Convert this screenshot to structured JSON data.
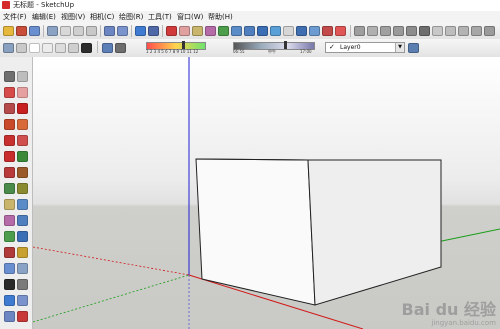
{
  "window": {
    "title": "无标题 - SketchUp"
  },
  "menu": [
    "文件(F)",
    "编辑(E)",
    "视图(V)",
    "相机(C)",
    "绘图(R)",
    "工具(T)",
    "窗口(W)",
    "帮助(H)"
  ],
  "toolbar_top": {
    "icons": [
      "select-icon",
      "orbit-icon",
      "pan-icon",
      "zoom-icon",
      "zoom-extents-icon",
      "prev-view-icon",
      "next-view-icon",
      "walk-icon",
      "look-around-icon",
      "position-camera-icon",
      "section-plane-icon",
      "paint-bucket-icon",
      "eraser-icon",
      "tape-measure-icon",
      "protractor-icon",
      "axes-icon",
      "dimension-icon",
      "text-icon",
      "3d-text-icon",
      "move-icon",
      "push-pull-icon",
      "rotate-icon",
      "follow-me-icon",
      "scale-icon",
      "offset-icon",
      "components-icon",
      "materials-icon",
      "styles-icon",
      "layers-icon",
      "scenes-icon",
      "shadows-icon",
      "fog-icon",
      "match-photo-icon",
      "soften-icon",
      "outliner-icon",
      "entity-info-icon"
    ]
  },
  "toolbar_second": {
    "style_icons": [
      "xray-icon",
      "back-edges-icon",
      "wireframe-icon",
      "hidden-line-icon",
      "shaded-icon",
      "shaded-textures-icon",
      "monochrome-icon"
    ],
    "shadow_ticks": "1 2 3 4 5 6 7 8 9 10 11 12",
    "shadow_months_fill": 0.62,
    "time_start": "06:55",
    "time_mid": "中午",
    "time_end": "17:00",
    "layer_name": "Layer0",
    "layer_checked": "✓"
  },
  "left_tools": [
    "select-icon",
    "component-icon",
    "paint-icon",
    "eraser-icon",
    "rectangle-icon",
    "line-icon",
    "circle-icon",
    "arc-icon",
    "polygon-icon",
    "freehand-icon",
    "move-icon",
    "push-pull-icon",
    "rotate-icon",
    "follow-me-icon",
    "scale-icon",
    "offset-icon",
    "tape-measure-icon",
    "dimension-icon",
    "protractor-icon",
    "text-icon",
    "axes-icon",
    "3d-text-icon",
    "orbit-icon",
    "pan-icon",
    "zoom-icon",
    "zoom-window-icon",
    "zoom-extents-icon",
    "previous-icon",
    "position-camera-icon",
    "look-around-icon",
    "walk-icon",
    "section-icon"
  ],
  "watermark": {
    "line1": "Bai du 经验",
    "line2": "jingyan.baidu.com"
  },
  "colors": {
    "axis_red": "#d11a1a",
    "axis_green": "#1a9e1a",
    "axis_blue": "#2020d0",
    "box_face_left": "#fafafa",
    "box_face_right": "#eeeeee",
    "ground": "#cfcfcb"
  }
}
